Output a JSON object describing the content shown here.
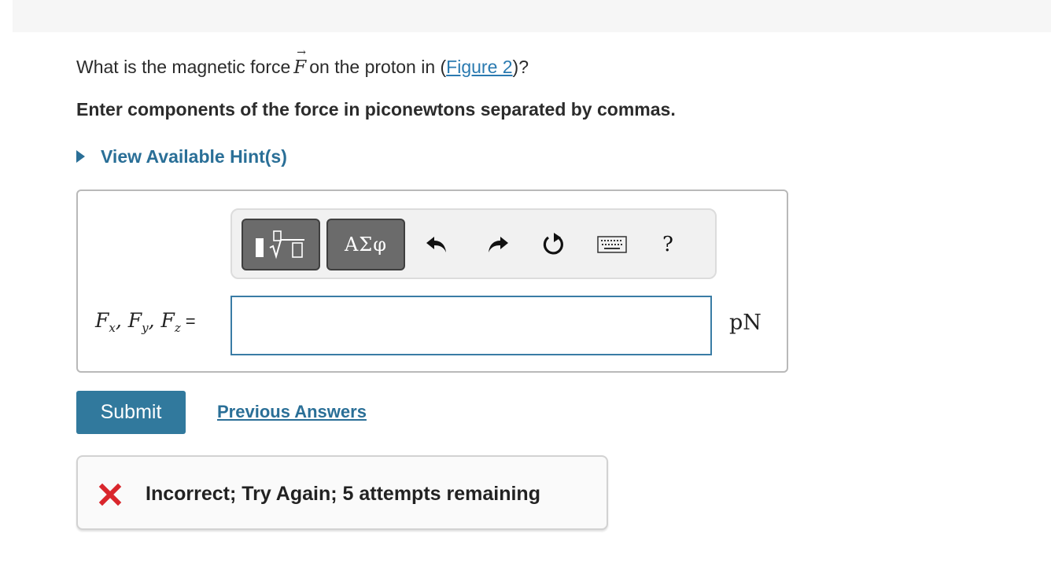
{
  "question": {
    "prefix": "What is the magnetic force",
    "symbol": "F",
    "middle": "on the proton in (",
    "figure_link": "Figure 2",
    "suffix": ")?"
  },
  "instruction": "Enter components of the force in piconewtons separated by commas.",
  "hint_label": "View Available Hint(s)",
  "toolbar": {
    "greek_label": "ΑΣφ",
    "help_label": "?",
    "icons": [
      "templates-icon",
      "undo-icon",
      "redo-icon",
      "reset-icon",
      "keyboard-icon",
      "help-icon"
    ]
  },
  "answer": {
    "label": {
      "f": "F",
      "x": "x",
      "y": "y",
      "z": "z",
      "sep": ", ",
      "eq": "="
    },
    "value": "",
    "unit": "pN"
  },
  "submit_label": "Submit",
  "previous_answers_label": "Previous Answers",
  "feedback": {
    "message": "Incorrect; Try Again; 5 attempts remaining",
    "status_color": "#d9262c"
  },
  "colors": {
    "link": "#2a7ab0",
    "accent": "#31799d",
    "input_border": "#3a7ca5"
  }
}
